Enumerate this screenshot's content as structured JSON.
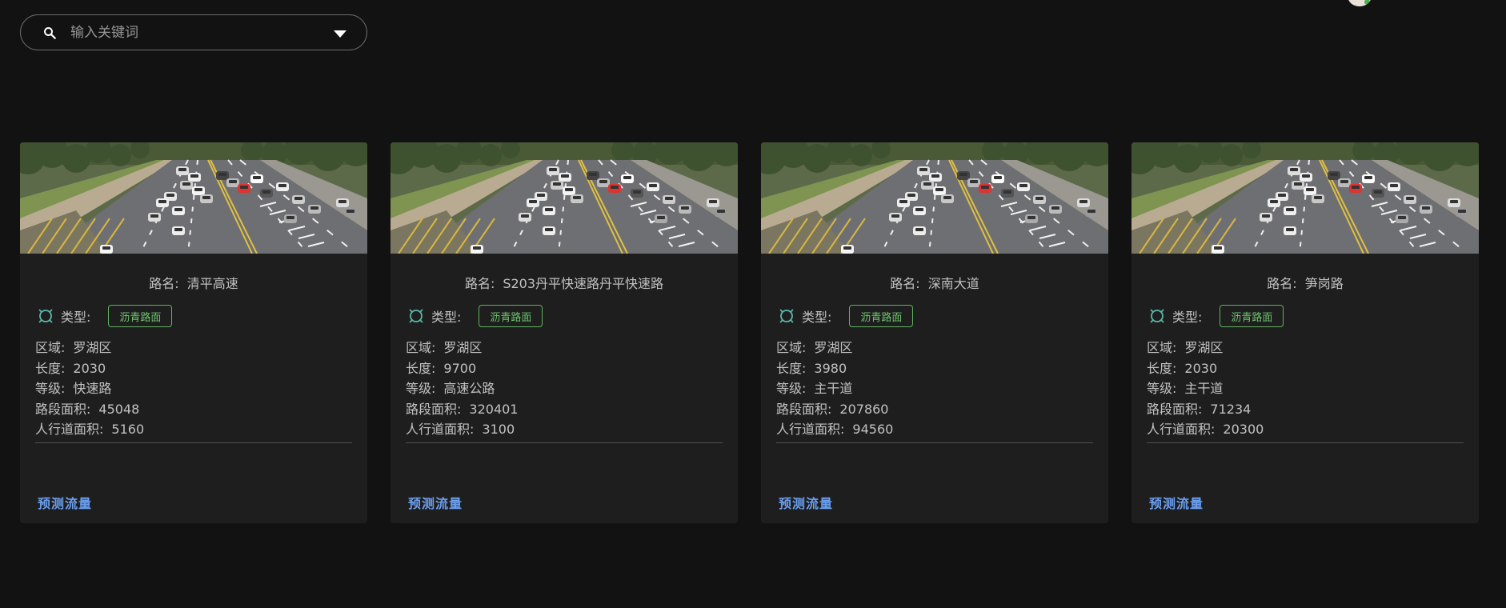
{
  "search": {
    "placeholder": "输入关键词",
    "value": ""
  },
  "cards": [
    {
      "name_label": "路名:",
      "name": "清平高速",
      "type_label": "类型:",
      "type": "沥青路面",
      "area_label": "区域:",
      "area": "罗湖区",
      "length_label": "长度:",
      "length": "2030",
      "grade_label": "等级:",
      "grade": "快速路",
      "segment_area_label": "路段面积:",
      "segment_area": "45048",
      "sidewalk_area_label": "人行道面积:",
      "sidewalk_area": "5160",
      "action": "预测流量"
    },
    {
      "name_label": "路名:",
      "name": "S203丹平快速路丹平快速路",
      "type_label": "类型:",
      "type": "沥青路面",
      "area_label": "区域:",
      "area": "罗湖区",
      "length_label": "长度:",
      "length": "9700",
      "grade_label": "等级:",
      "grade": "高速公路",
      "segment_area_label": "路段面积:",
      "segment_area": "320401",
      "sidewalk_area_label": "人行道面积:",
      "sidewalk_area": "3100",
      "action": "预测流量"
    },
    {
      "name_label": "路名:",
      "name": "深南大道",
      "type_label": "类型:",
      "type": "沥青路面",
      "area_label": "区域:",
      "area": "罗湖区",
      "length_label": "长度:",
      "length": "3980",
      "grade_label": "等级:",
      "grade": "主干道",
      "segment_area_label": "路段面积:",
      "segment_area": "207860",
      "sidewalk_area_label": "人行道面积:",
      "sidewalk_area": "94560",
      "action": "预测流量"
    },
    {
      "name_label": "路名:",
      "name": "笋岗路",
      "type_label": "类型:",
      "type": "沥青路面",
      "area_label": "区域:",
      "area": "罗湖区",
      "length_label": "长度:",
      "length": "2030",
      "grade_label": "等级:",
      "grade": "主干道",
      "segment_area_label": "路段面积:",
      "segment_area": "71234",
      "sidewalk_area_label": "人行道面积:",
      "sidewalk_area": "20300",
      "action": "预测流量"
    }
  ],
  "icons": {
    "search": "search-icon",
    "dropdown": "caret-down-icon",
    "type": "road-type-icon",
    "photo": "road-traffic-photo"
  },
  "colors": {
    "background": "#121212",
    "card": "#1e1e1e",
    "chip": "#6cc46c",
    "action": "#6b9ff0",
    "type_icon": "#5cb8a8"
  }
}
